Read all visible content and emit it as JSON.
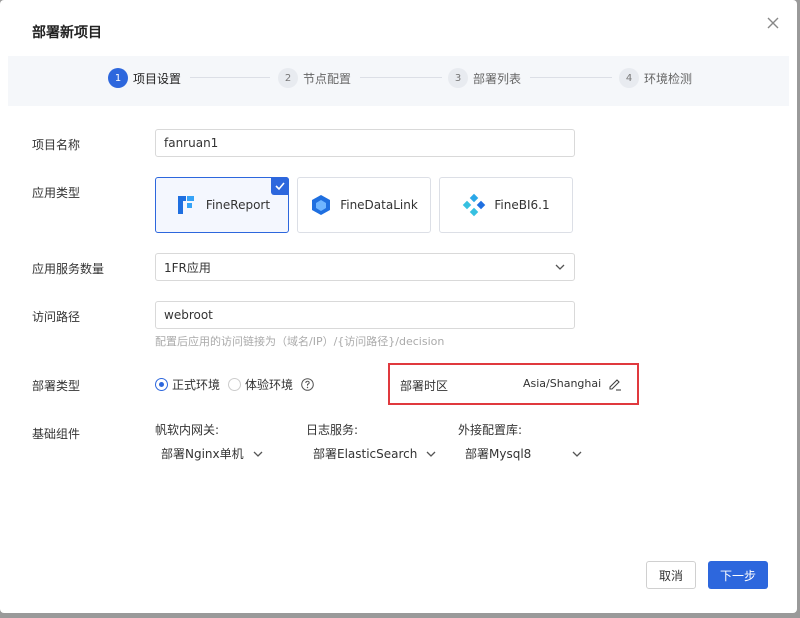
{
  "dialog": {
    "title": "部署新项目"
  },
  "steps": [
    {
      "num": "1",
      "label": "项目设置"
    },
    {
      "num": "2",
      "label": "节点配置"
    },
    {
      "num": "3",
      "label": "部署列表"
    },
    {
      "num": "4",
      "label": "环境检测"
    }
  ],
  "form": {
    "project_name": {
      "label": "项目名称",
      "value": "fanruan1"
    },
    "app_type": {
      "label": "应用类型",
      "options": [
        "FineReport",
        "FineDataLink",
        "FineBI6.1"
      ],
      "selected": "FineReport"
    },
    "service_count": {
      "label": "应用服务数量",
      "value": "1FR应用"
    },
    "access_path": {
      "label": "访问路径",
      "value": "webroot",
      "hint": "配置后应用的访问链接为（域名/IP）/{访问路径}/decision"
    },
    "deploy_type": {
      "label": "部署类型",
      "options": [
        "正式环境",
        "体验环境"
      ],
      "selected": "正式环境"
    },
    "timezone": {
      "label": "部署时区",
      "value": "Asia/Shanghai"
    },
    "components": {
      "label": "基础组件",
      "items": [
        {
          "label": "帆软内网关:",
          "value": "部署Nginx单机"
        },
        {
          "label": "日志服务:",
          "value": "部署ElasticSearch"
        },
        {
          "label": "外接配置库:",
          "value": "部署Mysql8"
        }
      ]
    }
  },
  "footer": {
    "cancel_label": "取消",
    "next_label": "下一步"
  },
  "colors": {
    "primary": "#2d67dd",
    "highlight_border": "#e0393e"
  }
}
